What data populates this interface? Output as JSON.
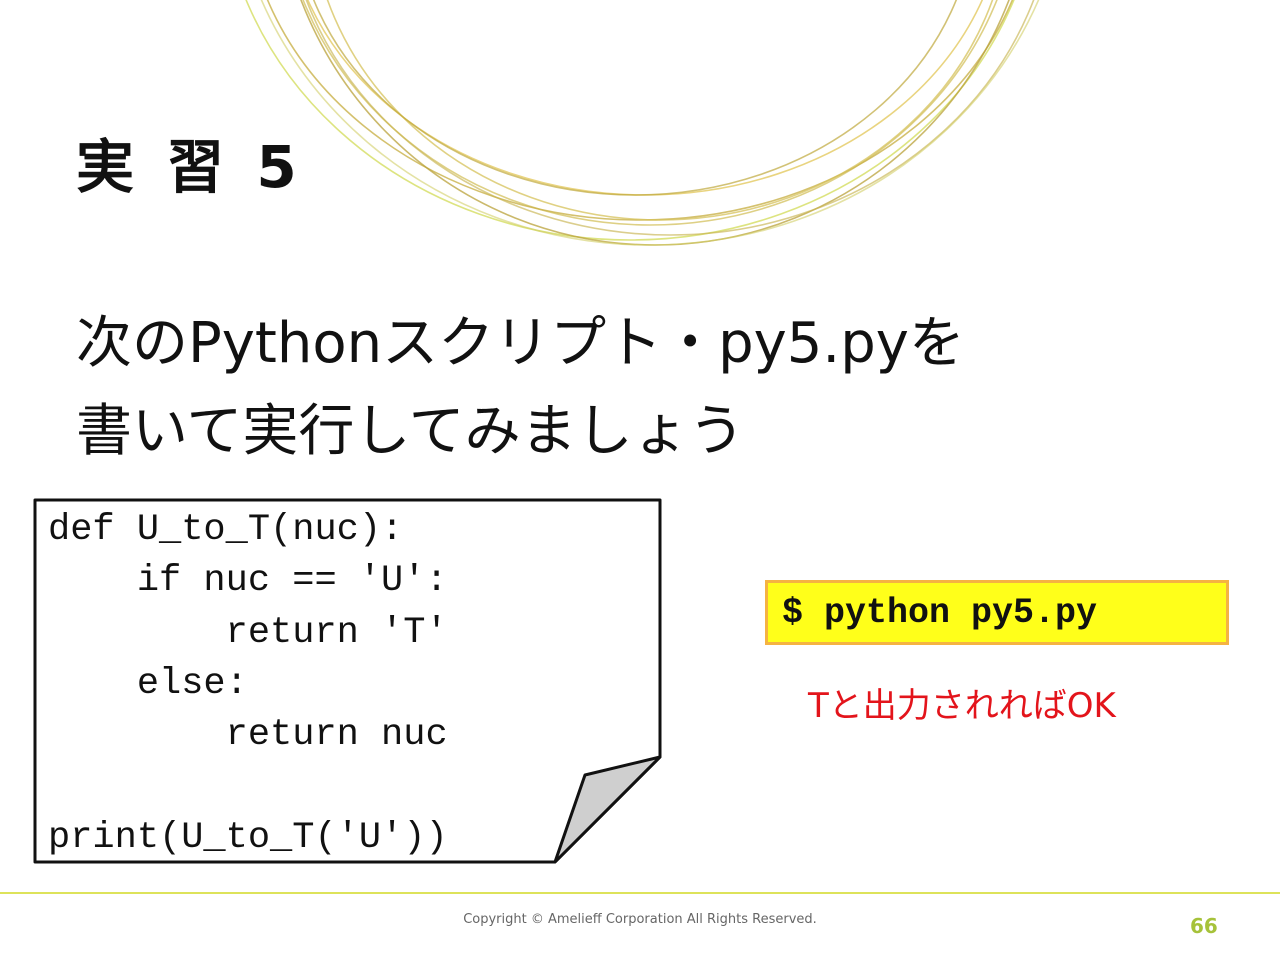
{
  "slide": {
    "title": "実 習 5",
    "instruction_lines": [
      "次のPythonスクリプト・py5.pyを",
      "書いて実行してみましょう"
    ],
    "code_lines": [
      "def U_to_T(nuc):",
      "    if nuc == 'U':",
      "        return 'T'",
      "    else:",
      "        return nuc",
      "",
      "print(U_to_T('U'))"
    ],
    "command": "$ python py5.py",
    "expected_note": "Tと出力されればOK"
  },
  "footer": {
    "copyright": "Copyright © Amelieff Corporation All Rights Reserved.",
    "page_number": "66"
  },
  "colors": {
    "accent_gold": "#c9a93a",
    "accent_green": "#cfd94a",
    "command_bg": "#ffff1a",
    "command_border": "#f5b342",
    "note_red": "#e3141b",
    "page_number": "#a6c23a"
  }
}
